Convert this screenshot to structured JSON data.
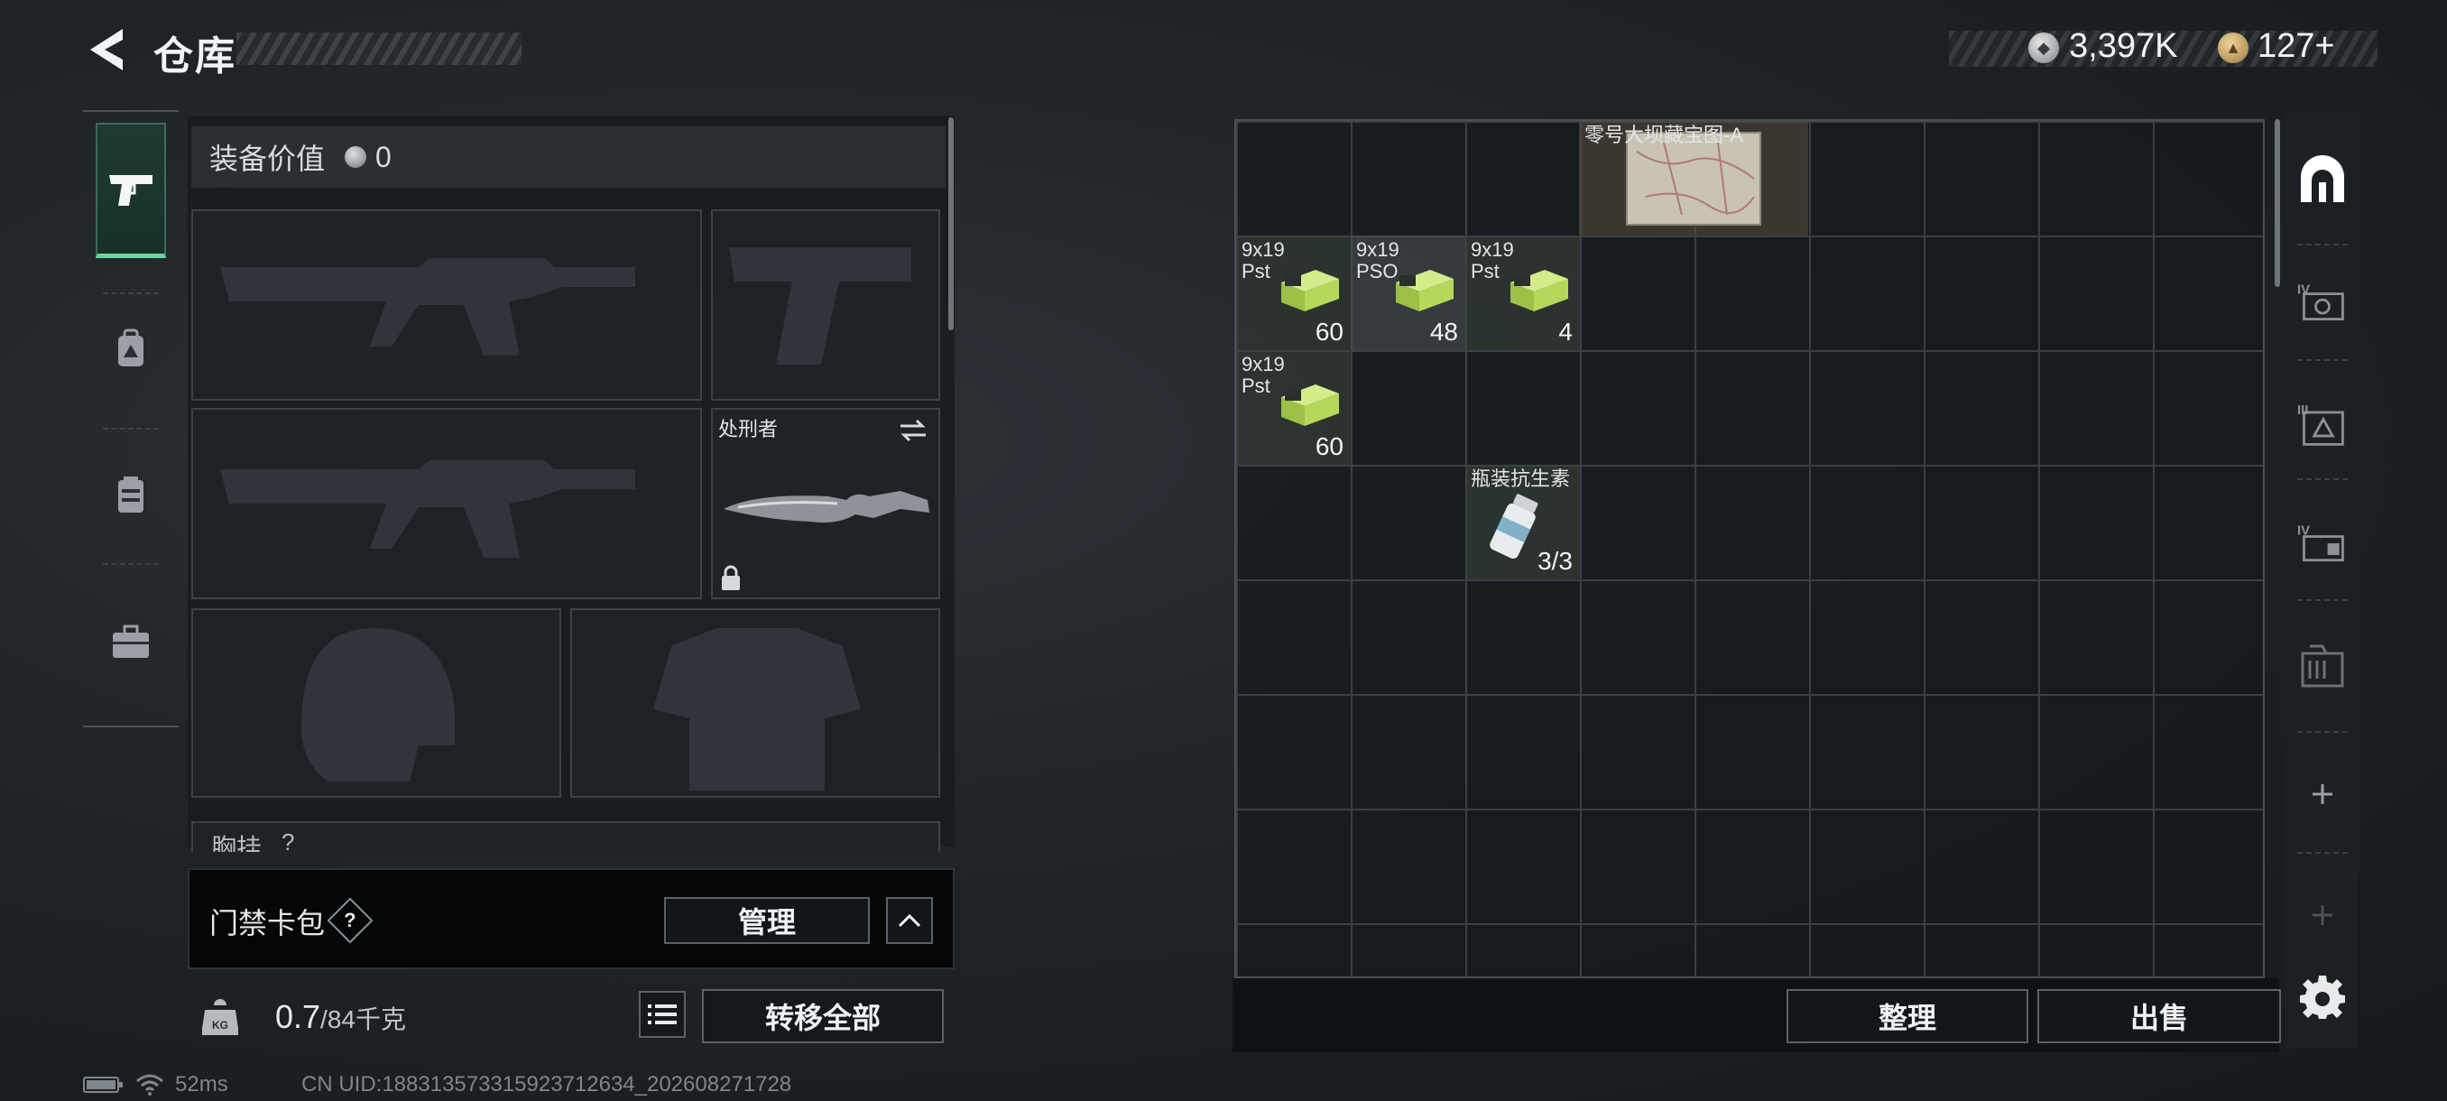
{
  "header": {
    "title": "仓库"
  },
  "currency": {
    "silver": "3,397K",
    "gold": "127+"
  },
  "equipment": {
    "value_label": "装备价值",
    "value": "0",
    "melee_name": "处刑者",
    "chest_rig_label": "胸挂",
    "chest_rig_hint": "?"
  },
  "card_pack": {
    "label": "门禁卡包",
    "help": "?",
    "manage_label": "管理"
  },
  "weight": {
    "current": "0.7",
    "max": "/84千克",
    "transfer_label": "转移全部"
  },
  "status": {
    "ping": "52ms",
    "uid": "CN UID:18831357331592371​2634_202608271728"
  },
  "grid_items": {
    "map": {
      "name": "零号大坝藏宝图-A"
    },
    "ammo1": {
      "name_line1": "9x19",
      "name_line2": "Pst",
      "count": "60"
    },
    "ammo2": {
      "name_line1": "9x19",
      "name_line2": "PSO",
      "count": "48"
    },
    "ammo3": {
      "name_line1": "9x19",
      "name_line2": "Pst",
      "count": "4"
    },
    "ammo4": {
      "name_line1": "9x19",
      "name_line2": "Pst",
      "count": "60"
    },
    "antibiotic": {
      "name": "瓶装抗生素",
      "count": "3/3"
    }
  },
  "grid_buttons": {
    "sort_label": "整理",
    "sell_label": "出售"
  },
  "icons": [
    "back-arrow-icon",
    "pistol-icon",
    "backpack-icon",
    "vest-icon",
    "briefcase-icon",
    "safe-icon",
    "container-icon",
    "swap-icon",
    "list-icon",
    "weight-icon",
    "gear-icon",
    "plus-icon",
    "lock-icon"
  ],
  "colors": {
    "accent": "#6fd39f",
    "background": "#1f2428",
    "ammo_box": "#b6d85a"
  }
}
